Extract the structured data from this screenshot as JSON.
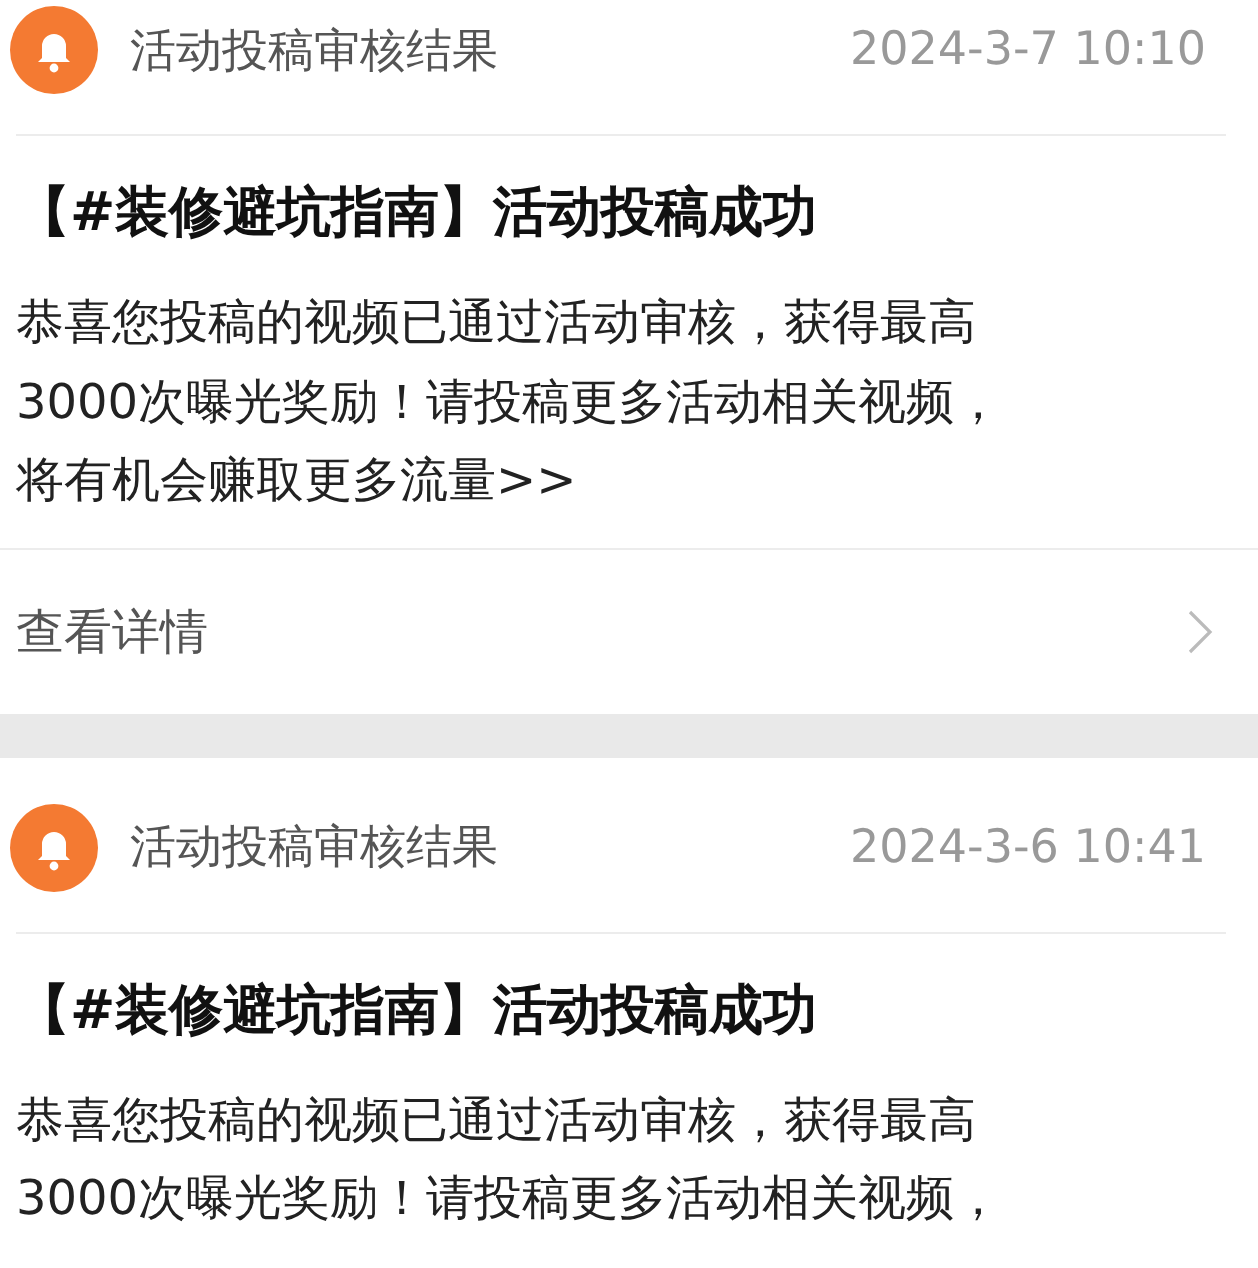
{
  "notifications": [
    {
      "category": "活动投稿审核结果",
      "time": "2024-3-7 10:10",
      "title": "【#装修避坑指南】活动投稿成功",
      "body_lines": [
        "恭喜您投稿的视频已通过活动审核，获得最高",
        "3000次曝光奖励！请投稿更多活动相关视频，",
        "将有机会赚取更多流量>>"
      ],
      "link": "查看详情"
    },
    {
      "category": "活动投稿审核结果",
      "time": "2024-3-6 10:41",
      "title": "【#装修避坑指南】活动投稿成功",
      "body_lines": [
        "恭喜您投稿的视频已通过活动审核，获得最高",
        "3000次曝光奖励！请投稿更多活动相关视频，"
      ]
    }
  ]
}
